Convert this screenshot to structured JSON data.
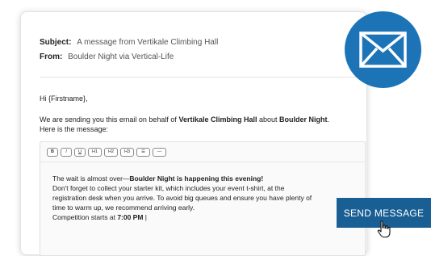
{
  "header": {
    "subject_label": "Subject:",
    "subject_value": "A message from Vertikale Climbing Hall",
    "from_label": "From:",
    "from_value": "Boulder Night via Vertical-Life"
  },
  "message": {
    "greeting": "Hi {Firstname},",
    "intro_1": "We are sending you this email on behalf of ",
    "intro_gym": "Vertikale Climbing Hall",
    "intro_2": " about ",
    "intro_event": "Boulder Night",
    "intro_3": ".",
    "intro_4": "Here is the message:"
  },
  "toolbar": {
    "buttons": [
      "B",
      "I",
      "U",
      "H1",
      "H2",
      "H3",
      "☰",
      "—"
    ]
  },
  "editor": {
    "line1_a": "The wait is almost over—",
    "line1_b": "Boulder Night is happening this evening!",
    "line2": "Don't forget to collect your starter kit, which includes your event t-shirt, at the",
    "line3": "registration desk when you arrive. To avoid big queues and ensure you have plenty of",
    "line4": "time to warm up, we recommend arriving early.",
    "line5_a": "Competition starts at ",
    "line5_b": "7:00 PM",
    "line5_c": " |"
  },
  "send_button": {
    "label": "SEND MESSAGE"
  },
  "colors": {
    "accent_circle": "#1c74b7",
    "send_button": "#1a5f93"
  },
  "icons": {
    "badge": "envelope-icon",
    "pointer": "hand-cursor-icon"
  }
}
